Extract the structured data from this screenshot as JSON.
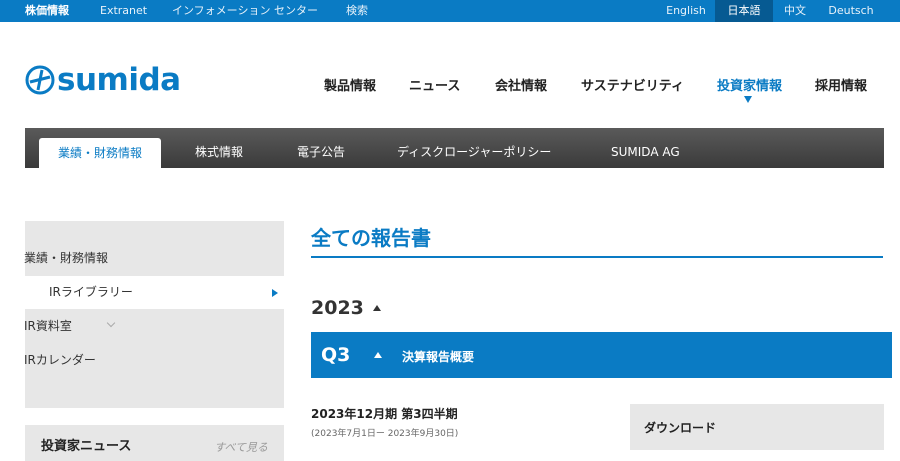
{
  "topbar": {
    "links": [
      "株価情報",
      "Extranet",
      "インフォメーション センター",
      "検索"
    ],
    "languages": [
      "English",
      "日本語",
      "中文",
      "Deutsch"
    ],
    "active_language": "日本語"
  },
  "brand": {
    "logo_text": "sumida"
  },
  "main_nav": {
    "items": [
      "製品情報",
      "ニュース",
      "会社情報",
      "サステナビリティ",
      "投資家情報",
      "採用情報"
    ],
    "active": "投資家情報"
  },
  "sub_nav": {
    "items": [
      "業績・財務情報",
      "株式情報",
      "電子公告",
      "ディスクロージャーポリシー",
      "SUMIDA AG"
    ],
    "active": "業績・財務情報"
  },
  "sidebar": {
    "items": [
      "業績・財務情報",
      "IRライブラリー",
      "IR資料室",
      "IRカレンダー"
    ],
    "current": "IRライブラリー",
    "news_box": {
      "heading": "投資家ニュース",
      "more_link": "すべて見る"
    }
  },
  "content": {
    "page_title": "全ての報告書",
    "year": "2023",
    "quarter": "Q3",
    "section_title": "決算報告概要",
    "report_title": "2023年12月期 第3四半期",
    "report_period": "(2023年7月1日ー 2023年9月30日)",
    "download_label": "ダウンロード"
  },
  "colors": {
    "brand_blue": "#0a7bc4",
    "subnav_dark": "#444444",
    "sidebar_gray": "#e7e7e7"
  }
}
